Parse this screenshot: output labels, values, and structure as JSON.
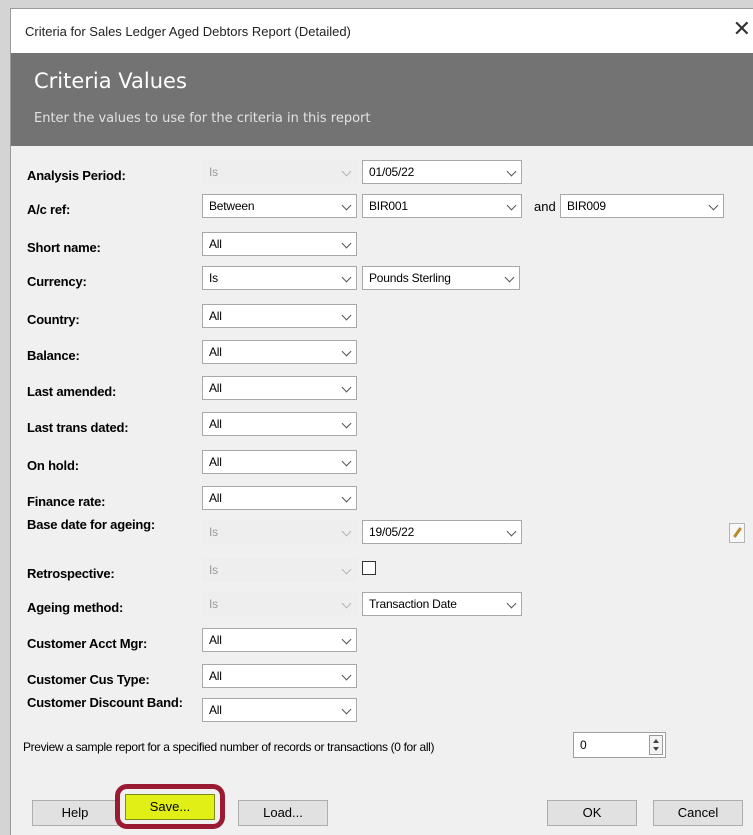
{
  "window": {
    "title": "Criteria for Sales Ledger Aged Debtors Report (Detailed)",
    "close_glyph": "✕"
  },
  "banner": {
    "title": "Criteria Values",
    "subtitle": "Enter the values to use for the criteria in this report"
  },
  "criteria": [
    {
      "label": "Analysis Period:",
      "operator": "Is",
      "operator_disabled": true,
      "value": "01/05/22"
    },
    {
      "label": "A/c ref:",
      "operator": "Between",
      "value": "BIR001",
      "and_text": "and",
      "value2": "BIR009"
    },
    {
      "label": "Short name:",
      "operator": "All"
    },
    {
      "label": "Currency:",
      "operator": "Is",
      "value": "Pounds Sterling"
    },
    {
      "label": "Country:",
      "operator": "All"
    },
    {
      "label": "Balance:",
      "operator": "All"
    },
    {
      "label": "Last amended:",
      "operator": "All"
    },
    {
      "label": "Last trans dated:",
      "operator": "All"
    },
    {
      "label": "On hold:",
      "operator": "All"
    },
    {
      "label": "Finance rate:",
      "operator": "All"
    },
    {
      "label": "Base date for ageing:",
      "operator": "Is",
      "operator_disabled": true,
      "value": "19/05/22",
      "has_edit_button": true
    },
    {
      "label": "Retrospective:",
      "operator": "Is",
      "operator_disabled": true,
      "checkbox_checked": false
    },
    {
      "label": "Ageing method:",
      "operator": "Is",
      "operator_disabled": true,
      "value": "Transaction Date"
    },
    {
      "label": "Customer Acct Mgr:",
      "operator": "All"
    },
    {
      "label": "Customer Cus Type:",
      "operator": "All"
    },
    {
      "label": "Customer Discount Band:",
      "operator": "All"
    }
  ],
  "preview": {
    "label": "Preview a sample report for a specified number of records or transactions (0 for all)",
    "value": "0"
  },
  "buttons": {
    "help": "Help",
    "save": "Save...",
    "load": "Load...",
    "ok": "OK",
    "cancel": "Cancel"
  },
  "colors": {
    "banner": "#737373",
    "save_highlight_fill": "#e2ef17",
    "save_highlight_ring": "#9a1a33"
  }
}
